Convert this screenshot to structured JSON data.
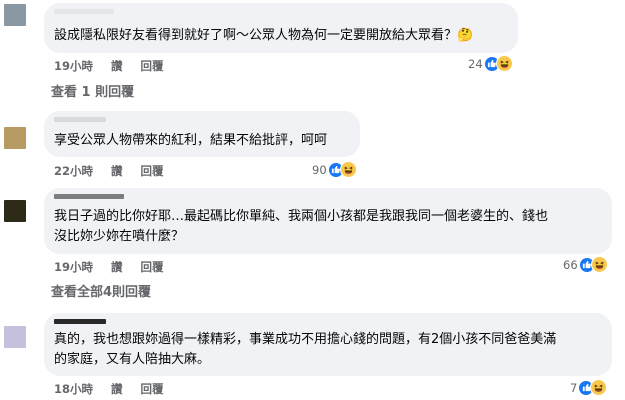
{
  "comments": [
    {
      "text_lines": [
        "設成隱私限好友看得到就好了啊～公眾人物為何一定要開放給大眾看？🤔"
      ],
      "time": "19小時",
      "like_label": "讚",
      "reply_label": "回覆",
      "reaction_count": "24",
      "avatar_color": "#8a98a4"
    },
    {
      "text_lines": [
        "享受公眾人物帶來的紅利，結果不給批評，呵呵"
      ],
      "time": "22小時",
      "like_label": "讚",
      "reply_label": "回覆",
      "reaction_count": "90",
      "avatar_color": "#b89a63"
    },
    {
      "text_lines": [
        "我日子過的比你好耶…最起碼比你單純、我兩個小孩都是我跟我同一個老婆生的、錢也",
        "沒比妳少妳在噴什麼？"
      ],
      "time": "19小時",
      "like_label": "讚",
      "reply_label": "回覆",
      "reaction_count": "66",
      "avatar_color": "#2e2a18"
    },
    {
      "text_lines": [
        "真的，我也想跟妳過得一樣精彩，事業成功不用擔心錢的問題，有2個小孩不同爸爸美滿",
        "的家庭，又有人陪抽大麻。"
      ],
      "time": "18小時",
      "like_label": "讚",
      "reply_label": "回覆",
      "reaction_count": "7",
      "avatar_color": "#c5c1dc"
    }
  ],
  "view_replies": [
    "查看 1 則回覆",
    "查看全部4則回覆"
  ],
  "colors": {
    "bubble_bg": "#f0f2f5",
    "meta_text": "#65676b",
    "like_blue": "#1877f2",
    "haha_yellow": "#f7c84b"
  },
  "icons": [
    "like-reaction-icon",
    "haha-reaction-icon"
  ]
}
